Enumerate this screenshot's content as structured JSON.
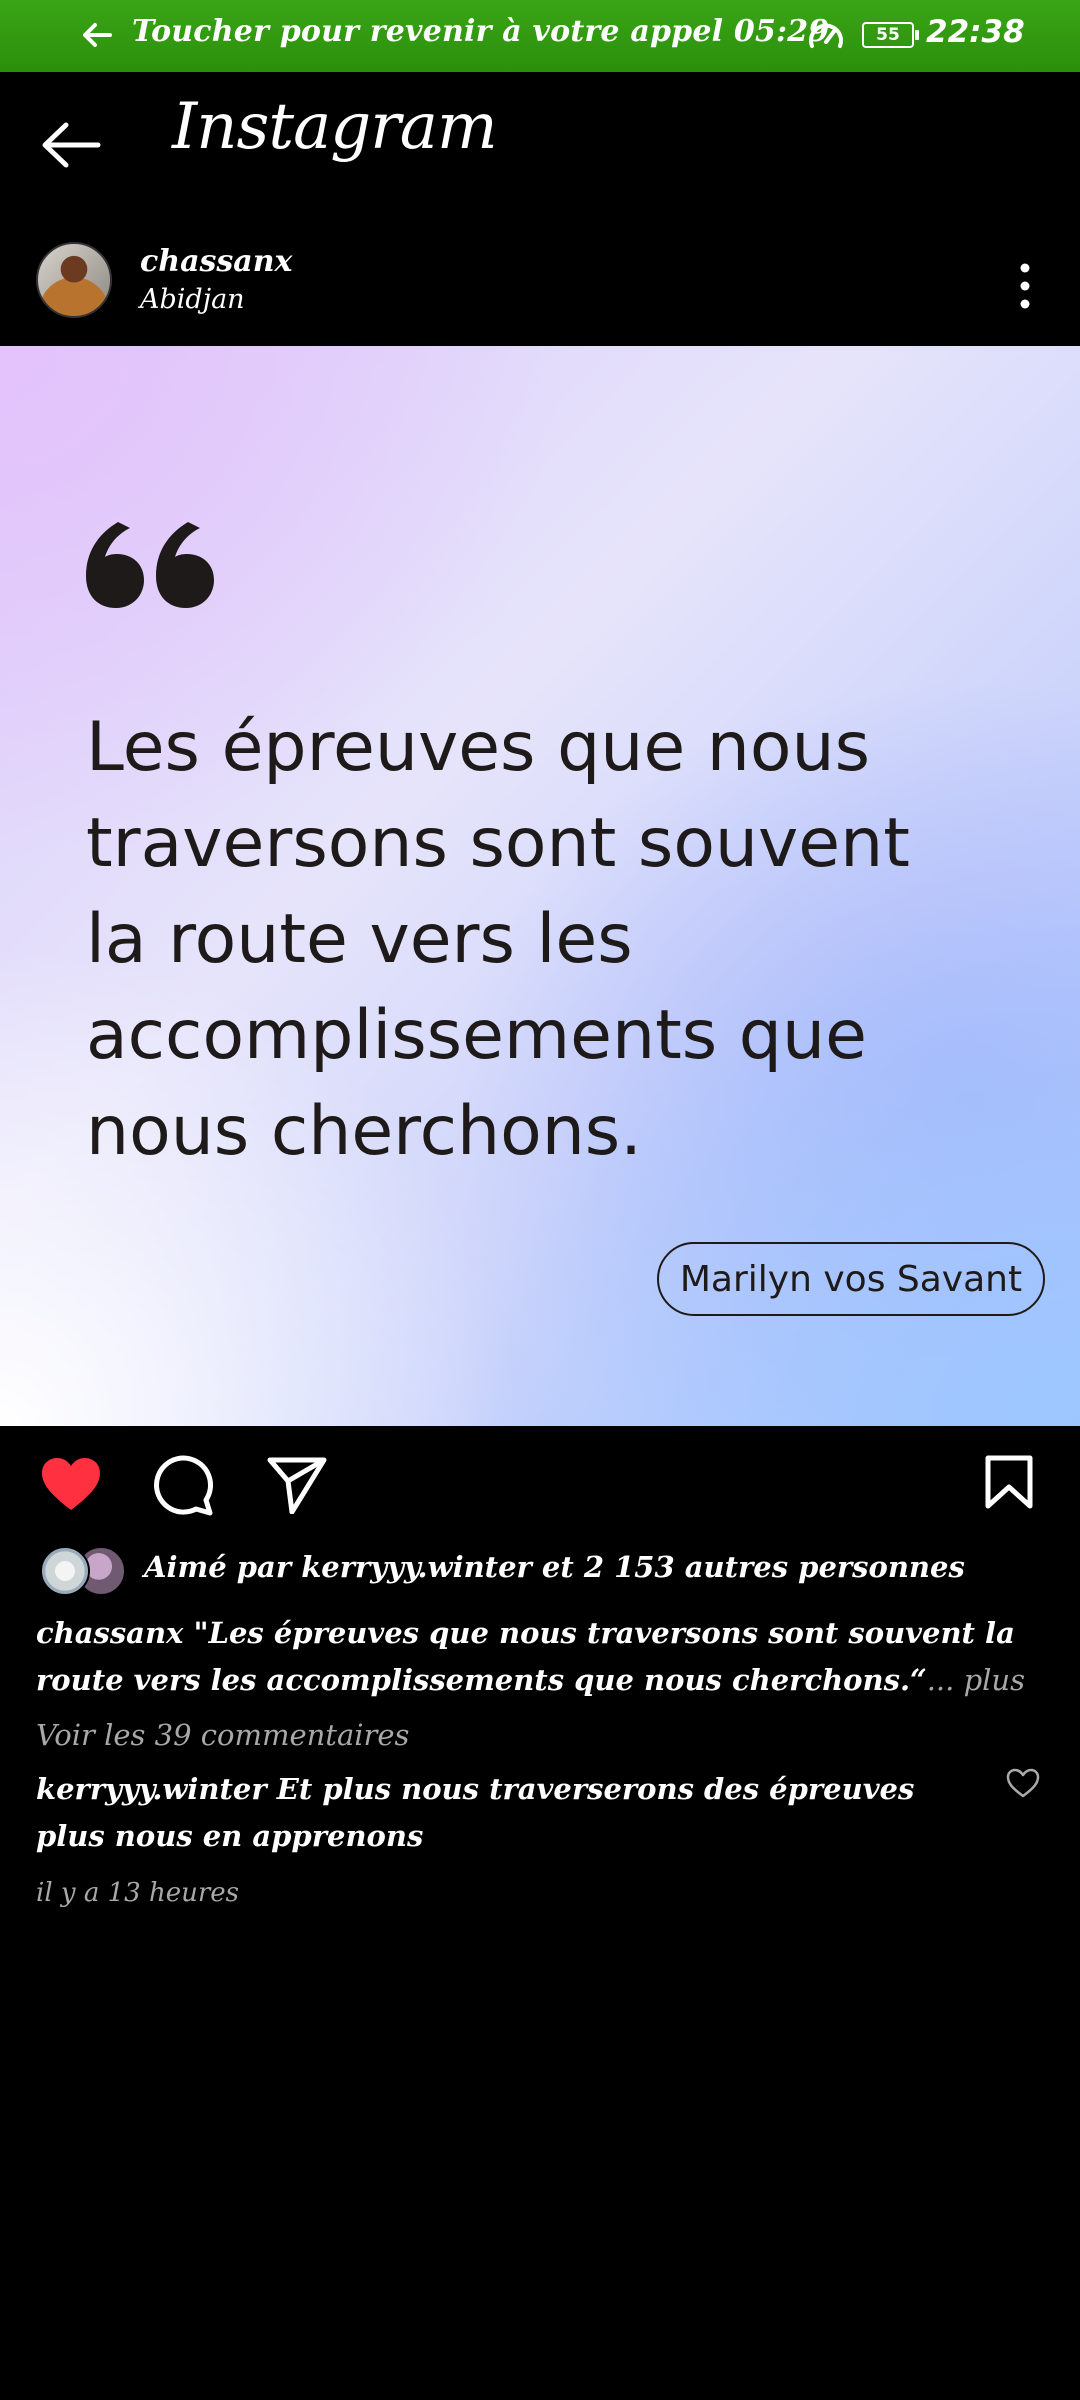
{
  "callbar": {
    "text": "Toucher pour revenir à votre appel 05:29",
    "battery": "55",
    "clock": "22:38",
    "bg_color": "#2f9a10"
  },
  "appbar": {
    "title": "Instagram"
  },
  "post": {
    "username": "chassanx",
    "location": "Abidjan",
    "image": {
      "quote": "Les épreuves que nous traversons sont souvent la route vers les accomplissements que nous cherchons.",
      "author": "Marilyn vos Savant"
    },
    "actions": {
      "liked": true,
      "like_color": "#ff3040"
    },
    "likes_text": "Aimé par kerryyy.winter et 2 153 autres personnes",
    "caption": {
      "username": "chassanx",
      "text": "\"Les épreuves que nous traversons sont souvent la route vers les accomplissements que nous cherchons.“",
      "more": "... plus"
    },
    "comments_link": "Voir les 39 commentaires",
    "top_comment": {
      "username": "kerryyy.winter",
      "text": "Et plus nous traverserons des épreuves plus nous en apprenons"
    },
    "time": "il y a 13 heures"
  },
  "icons": [
    "back-arrow-icon",
    "speedometer-icon",
    "battery-icon",
    "more-options-icon",
    "heart-icon",
    "comment-icon",
    "share-icon",
    "bookmark-icon"
  ]
}
